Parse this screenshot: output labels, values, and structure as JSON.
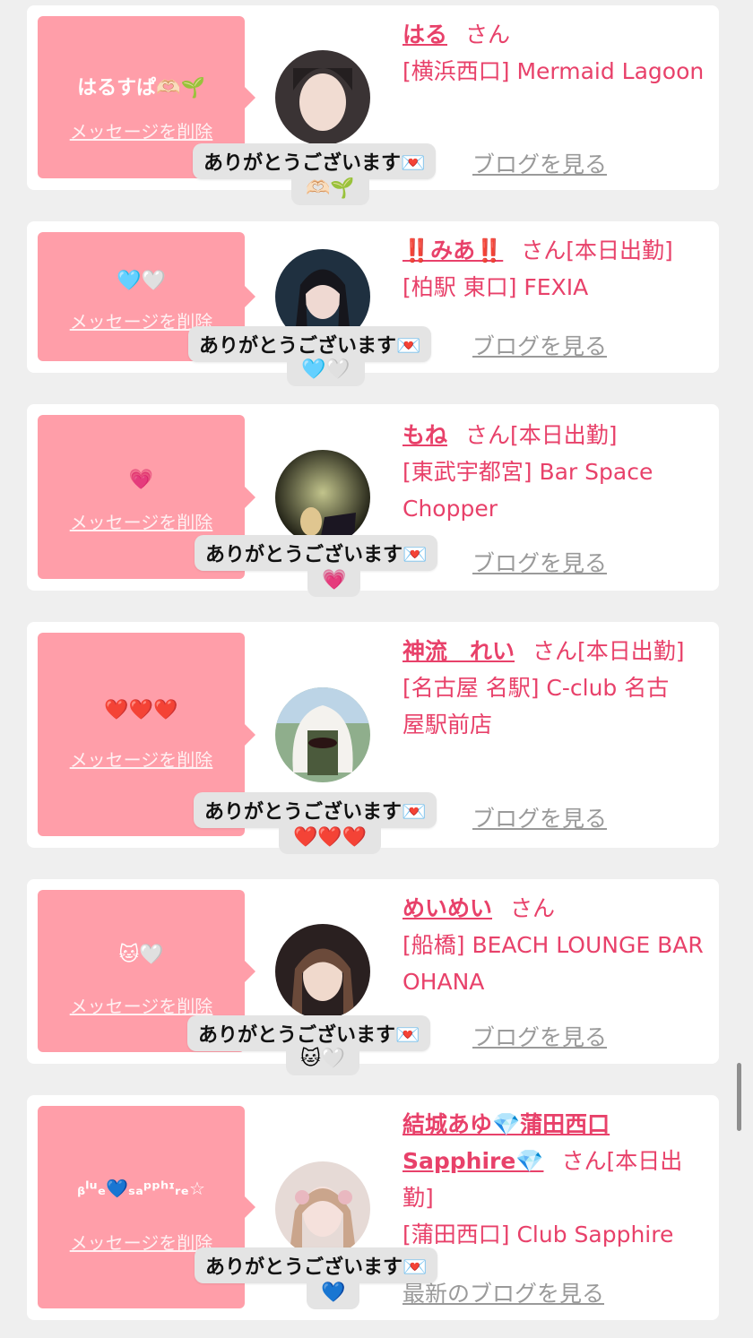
{
  "common": {
    "delete_label": "メッセージを削除",
    "san_label": "さん",
    "reaction_text": "ありがとうございます💌",
    "blog_label": "ブログを見る",
    "blog_label_latest": "最新のブログを見る"
  },
  "cards": [
    {
      "message": "はるすぱ🫶🏻🌱",
      "name": "はる",
      "badge": "",
      "shop": "[横浜西口] Mermaid Lagoon",
      "reaction_emoji": "🫶🏻🌱"
    },
    {
      "message": "🩵🤍",
      "name": "‼️みあ‼️",
      "badge": "[本日出勤]",
      "shop": "[柏駅 東口] FEXIA",
      "reaction_emoji": "🩵🤍"
    },
    {
      "message": "💗",
      "name": "もね",
      "badge": "[本日出勤]",
      "shop": "[東武宇都宮] Bar Space Chopper",
      "reaction_emoji": "💗"
    },
    {
      "message": "❤️❤️❤️",
      "name": "神流　れい",
      "badge": "[本日出勤]",
      "shop": "[名古屋 名駅] C-club 名古屋駅前店",
      "reaction_emoji": "❤️❤️❤️"
    },
    {
      "message": "🐱🤍",
      "name": "めいめい",
      "badge": "",
      "shop": "[船橋] BEACH LOUNGE BAR OHANA",
      "reaction_emoji": "🐱🤍"
    },
    {
      "message": "ᵦˡᵘₑ💙ₛₐᵖᵖʰᶦᵣₑ☆",
      "name": "結城あゆ💎蒲田西口Sapphire💎",
      "badge": "[本日出勤]",
      "shop": "[蒲田西口] Club Sapphire",
      "reaction_emoji": "💙"
    }
  ],
  "colors": {
    "accent": "#e8416a",
    "message_bg": "#ff9ea9",
    "muted": "#9a9a9a"
  }
}
